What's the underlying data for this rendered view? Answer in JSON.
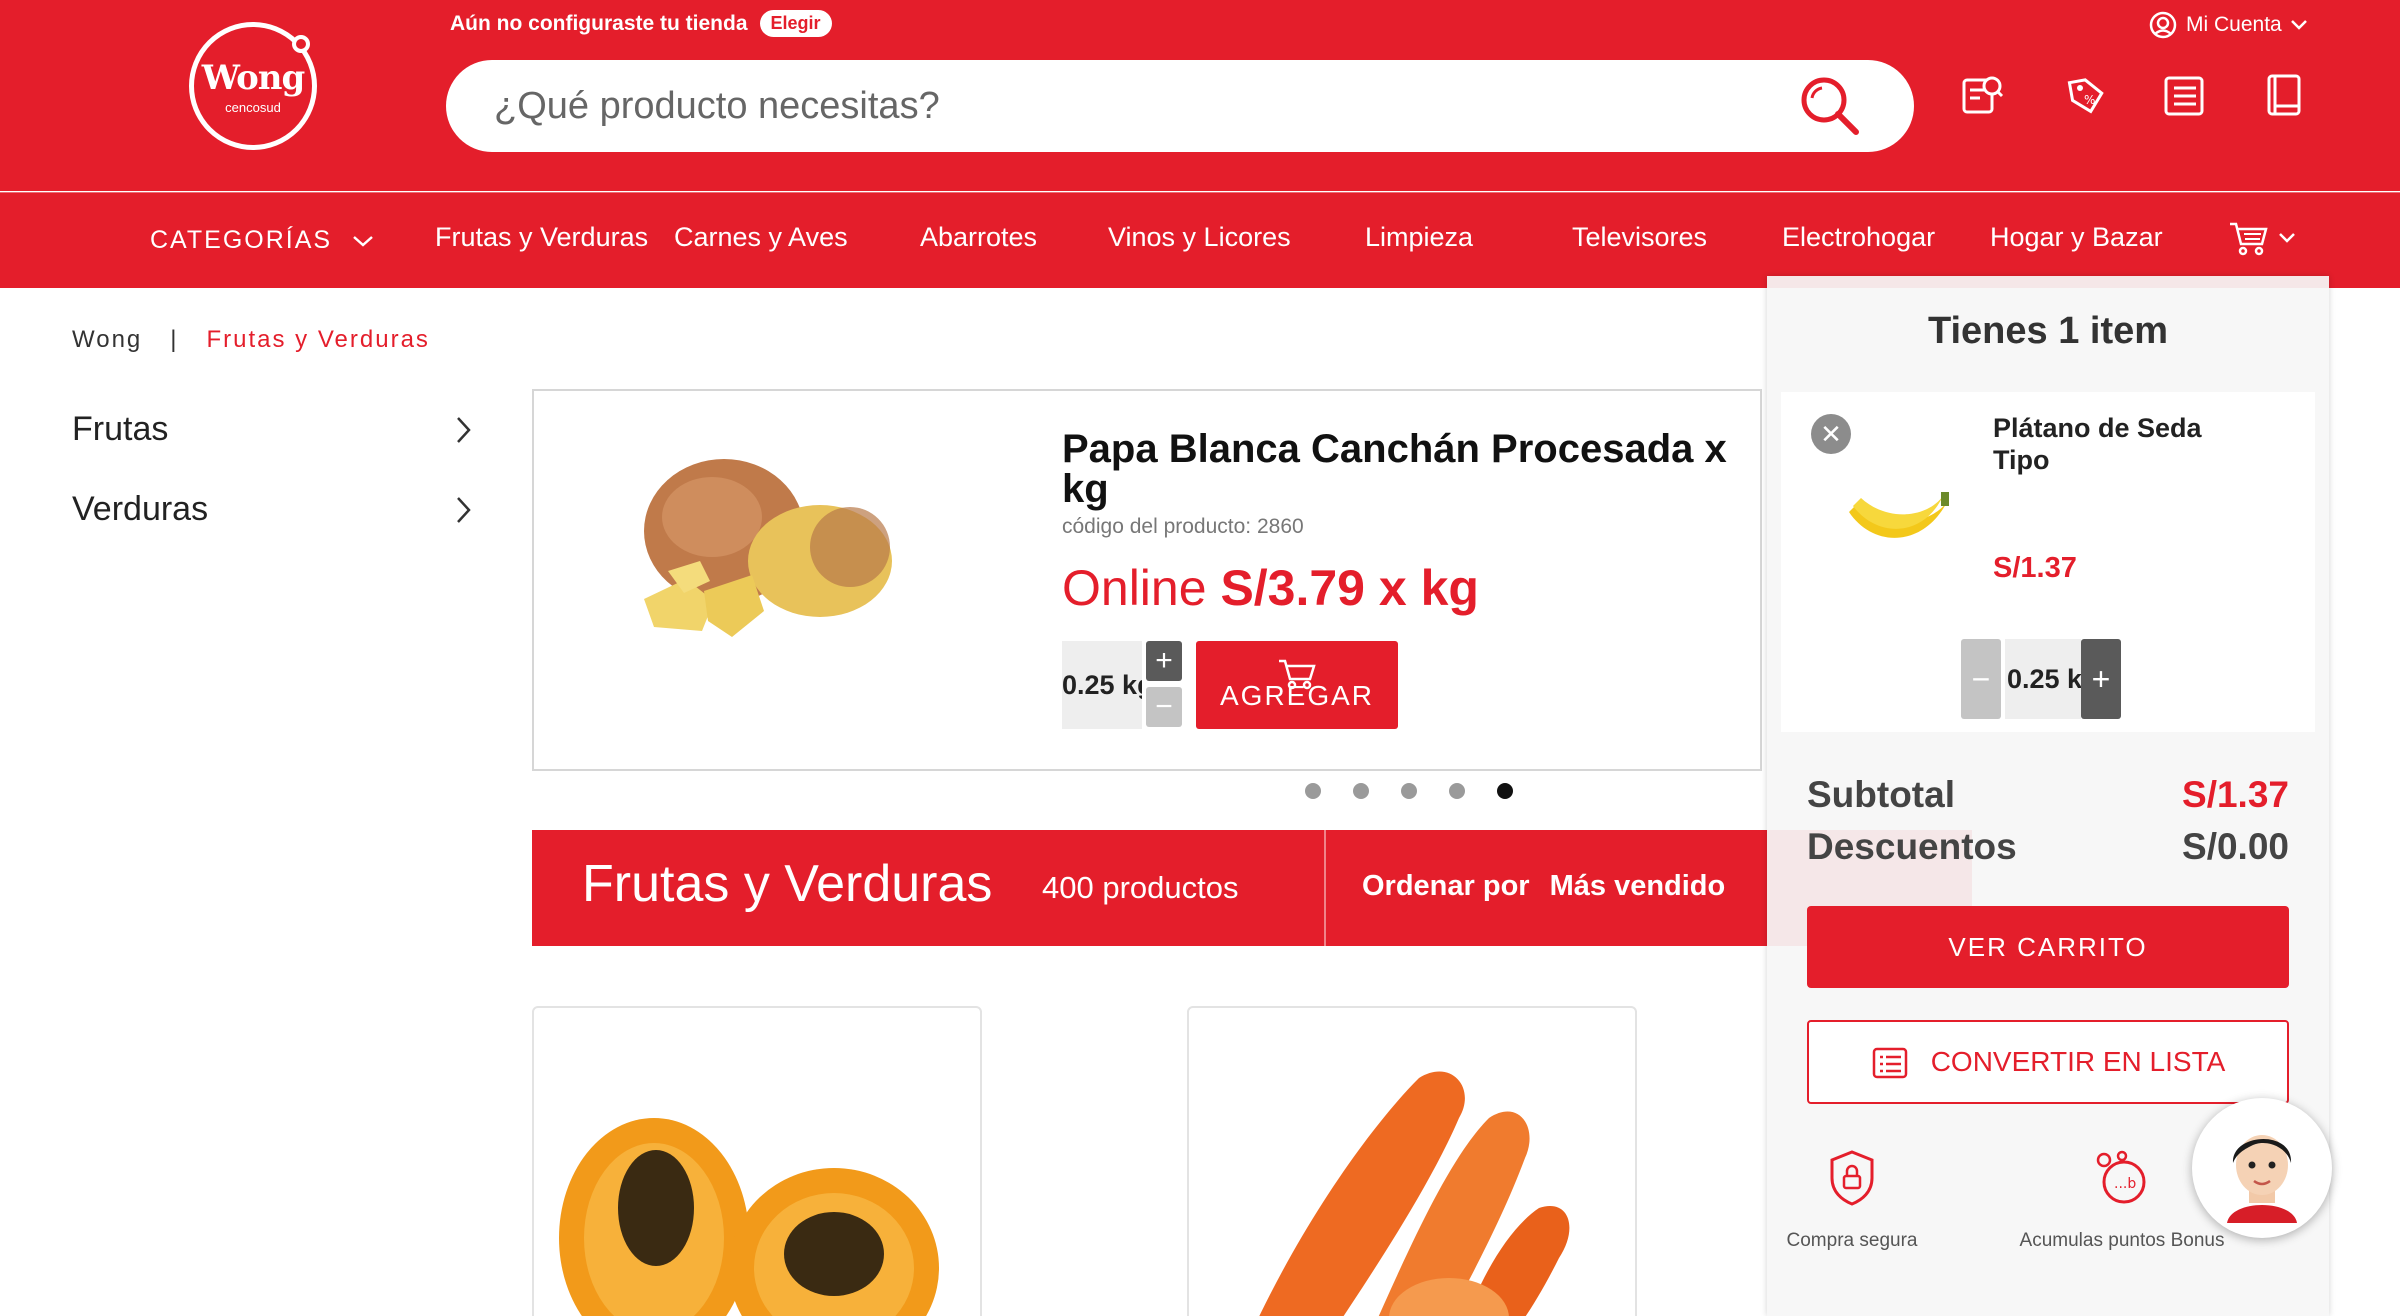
{
  "header": {
    "logo_text": "Wong",
    "logo_sub": "cencosud",
    "store_note": "Aún no configuraste tu tienda",
    "store_button": "Elegir",
    "account_label": "Mi Cuenta",
    "search_placeholder": "¿Qué producto necesitas?"
  },
  "nav": {
    "categories": "CATEGORÍAS",
    "items": [
      "Frutas y Verduras",
      "Carnes y Aves",
      "Abarrotes",
      "Vinos y Licores",
      "Limpieza",
      "Televisores",
      "Electrohogar",
      "Hogar y Bazar"
    ]
  },
  "breadcrumb": {
    "home": "Wong",
    "sep": "|",
    "current": "Frutas y Verduras"
  },
  "sidebar": {
    "items": [
      "Frutas",
      "Verduras"
    ]
  },
  "featured": {
    "name": "Papa Blanca Canchán Procesada x kg",
    "code": "código del producto: 2860",
    "price_prefix": "Online",
    "price": "S/3.79 x kg",
    "quantity": "0.25 kg",
    "add_label": "AGREGAR",
    "slides": 5,
    "active_slide": 5
  },
  "category_banner": {
    "title": "Frutas y Verduras",
    "count": "400 productos",
    "sort_label": "Ordenar por",
    "sort_value": "Más vendido"
  },
  "cart": {
    "title": "Tienes 1 item",
    "item": {
      "name": "Plátano de Seda Tipo",
      "price": "S/1.37",
      "quantity": "0.25 kg"
    },
    "subtotal_label": "Subtotal",
    "subtotal_value": "S/1.37",
    "discount_label": "Descuentos",
    "discount_value": "S/0.00",
    "view_cart": "VER CARRITO",
    "convert_list": "CONVERTIR EN LISTA",
    "benefit_secure": "Compra segura",
    "benefit_points": "Acumulas puntos Bonus"
  },
  "colors": {
    "brand_red": "#e41e2b",
    "dark_button": "#5a5a5a",
    "disabled_button": "#c4c4c4"
  }
}
